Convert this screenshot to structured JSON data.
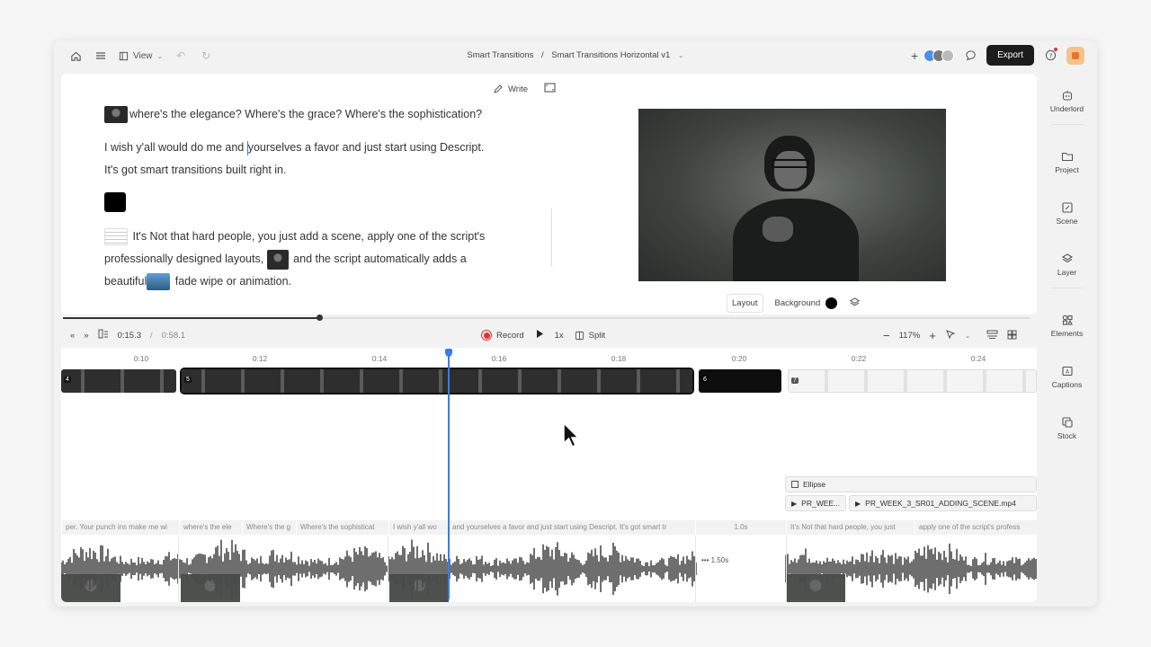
{
  "topbar": {
    "view_label": "View",
    "breadcrumb": {
      "project": "Smart Transitions",
      "separator": "/",
      "composition": "Smart Transitions Horizontal v1"
    },
    "export_label": "Export",
    "icons": [
      "home-icon",
      "menu-icon",
      "view-icon",
      "undo-icon",
      "redo-icon",
      "add-icon",
      "comment-icon",
      "help-icon"
    ]
  },
  "canvas": {
    "write_label": "Write",
    "script": {
      "line1": "where's the elegance? Where's the grace? Where's the sophistication?",
      "line2a": "I wish y'all would do me and ",
      "line2b": "yourselves a favor and just start using Descript.",
      "line3": "It's got smart transitions built right in.",
      "para3a": "It's Not that hard people, you just add a scene, apply one of the script's",
      "para3b": "professionally designed layouts,",
      "para3c": "and the script automatically adds a",
      "para3d": "beautiful",
      "para3e": "fade wipe or animation."
    },
    "preview_controls": {
      "layout_label": "Layout",
      "background_label": "Background",
      "background_color": "#000000"
    }
  },
  "controls": {
    "current_time": "0:15.3",
    "separator": "/",
    "total_time": "0:58.1",
    "record_label": "Record",
    "speed_label": "1x",
    "split_label": "Split",
    "zoom_label": "117%"
  },
  "timeline": {
    "ruler_ticks": [
      "0:10",
      "0:12",
      "0:14",
      "0:16",
      "0:18",
      "0:20",
      "0:22",
      "0:24"
    ],
    "scenes": [
      {
        "number": "4",
        "kind": "video"
      },
      {
        "number": "5",
        "kind": "video"
      },
      {
        "number": "6",
        "kind": "black"
      },
      {
        "number": "7",
        "kind": "docs"
      }
    ],
    "layers": {
      "ellipse_label": "Ellipse",
      "clip1_label": "PR_WEE...",
      "clip2_label": "PR_WEEK_3_SR01_ADDING_SCENE.mp4"
    },
    "transcript_words": [
      "per. Your punch ins make me wi",
      "where's the ele",
      "Where's the g",
      "Where's the sophisticat",
      "I wish y'all wo",
      "and yourselves a favor and just start using Descript. It's got smart tr",
      "1.0s",
      "It's Not that hard people, you just",
      "apply one of the script's profess"
    ],
    "gap_label": "1.50s"
  },
  "right_panel": {
    "items": [
      {
        "label": "Underlord",
        "icon": "robot-icon"
      },
      {
        "label": "Project",
        "icon": "folder-icon"
      },
      {
        "label": "Scene",
        "icon": "scene-icon"
      },
      {
        "label": "Layer",
        "icon": "layers-icon"
      },
      {
        "label": "Elements",
        "icon": "elements-icon"
      },
      {
        "label": "Captions",
        "icon": "captions-icon"
      },
      {
        "label": "Stock",
        "icon": "stock-icon"
      }
    ]
  },
  "colors": {
    "accent": "#3a7bf0",
    "record": "#dd3333",
    "export_bg": "#1c1c1c"
  }
}
